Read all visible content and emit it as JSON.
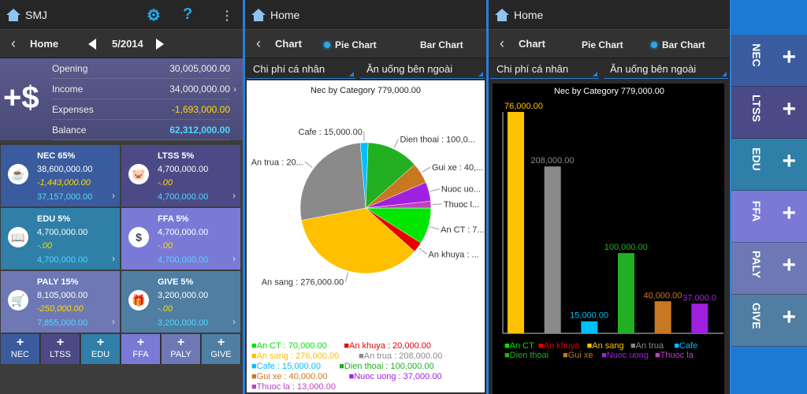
{
  "panel1": {
    "app_title": "SMJ",
    "nav": {
      "title": "Home",
      "month": "5/2014"
    },
    "summary": [
      {
        "label": "Opening",
        "value": "30,005,000.00",
        "color": "#eeeeee"
      },
      {
        "label": "Income",
        "value": "34,000,000.00",
        "color": "#eeeeee"
      },
      {
        "label": "Expenses",
        "value": "-1,693,000.00",
        "color": "#ffd700"
      },
      {
        "label": "Balance",
        "value": "62,312,000.00",
        "color": "#4fd8ff"
      }
    ],
    "tiles": [
      {
        "title": "NEC 65%",
        "v1": "38,600,000.00",
        "v2": "-1,443,000.00",
        "v3": "37,157,000.00",
        "bg": "#3a5c9e",
        "icon": "dining-icon"
      },
      {
        "title": "LTSS 5%",
        "v1": "4,700,000.00",
        "v2": "-.00",
        "v3": "4,700,000.00",
        "bg": "#4c4a86",
        "icon": "piggy-bank-icon"
      },
      {
        "title": "EDU 5%",
        "v1": "4,700,000.00",
        "v2": "-.00",
        "v3": "4,700,000.00",
        "bg": "#2f7fa8",
        "icon": "book-icon"
      },
      {
        "title": "FFA 5%",
        "v1": "4,700,000.00",
        "v2": "-.00",
        "v3": "4,700,000.00",
        "bg": "#7a7ad6",
        "icon": "money-bag-icon"
      },
      {
        "title": "PALY 15%",
        "v1": "8,105,000.00",
        "v2": "-250,000.00",
        "v3": "7,855,000.00",
        "bg": "#6e78b4",
        "icon": "shopping-cart-icon"
      },
      {
        "title": "GIVE 5%",
        "v1": "3,200,000.00",
        "v2": "-.00",
        "v3": "3,200,000.00",
        "bg": "#4f7ea2",
        "icon": "gift-icon"
      }
    ],
    "buttons": [
      {
        "label": "NEC",
        "bg": "#3a5c9e"
      },
      {
        "label": "LTSS",
        "bg": "#4c4a86"
      },
      {
        "label": "EDU",
        "bg": "#2f7fa8"
      },
      {
        "label": "FFA",
        "bg": "#7a7ad6"
      },
      {
        "label": "PALY",
        "bg": "#6e78b4"
      },
      {
        "label": "GIVE",
        "bg": "#4f7ea2"
      }
    ]
  },
  "chart_common": {
    "home": "Home",
    "chart": "Chart",
    "tab_pie": "Pie Chart",
    "tab_bar": "Bar Chart",
    "dropdown1": "Chi phí cá nhân",
    "dropdown2": "Ăn uống bên ngoài"
  },
  "chart_data": [
    {
      "type": "pie",
      "title": "Nec by Category 779,000.00",
      "slices": [
        {
          "name": "An CT",
          "value": 70000,
          "color": "#00e600",
          "label": "An CT : 7..."
        },
        {
          "name": "An khuya",
          "value": 20000,
          "color": "#e60000",
          "label": "An khuya : ..."
        },
        {
          "name": "An sang",
          "value": 276000,
          "color": "#ffc000",
          "label": "An sang : 276,000.00"
        },
        {
          "name": "An trua",
          "value": 208000,
          "color": "#8a8a8a",
          "label": "An trua : 20..."
        },
        {
          "name": "Cafe",
          "value": 15000,
          "color": "#00bfff",
          "label": "Cafe : 15,000.00"
        },
        {
          "name": "Dien thoai",
          "value": 100000,
          "color": "#22b022",
          "label": "Dien thoai : 100,0..."
        },
        {
          "name": "Gui xe",
          "value": 40000,
          "color": "#c87820",
          "label": "Gui xe : 40,..."
        },
        {
          "name": "Nuoc uong",
          "value": 37000,
          "color": "#a020e0",
          "label": "Nuoc uo..."
        },
        {
          "name": "Thuoc la",
          "value": 13000,
          "color": "#c040c0",
          "label": "Thuoc l..."
        }
      ],
      "legend": [
        [
          {
            "text": "An CT : 70,000.00",
            "color": "#00e600"
          },
          {
            "text": "An khuya : 20,000.00",
            "color": "#e60000"
          }
        ],
        [
          {
            "text": "An sang : 276,000.00",
            "color": "#ffc000"
          },
          {
            "text": "An trua : 208,000.00",
            "color": "#8a8a8a"
          }
        ],
        [
          {
            "text": "Cafe : 15,000.00",
            "color": "#00bfff"
          },
          {
            "text": "Dien thoai : 100,000.00",
            "color": "#22b022"
          }
        ],
        [
          {
            "text": "Gui xe : 40,000.00",
            "color": "#c87820"
          },
          {
            "text": "Nuoc uong : 37,000.00",
            "color": "#a020e0"
          }
        ],
        [
          {
            "text": "Thuoc la : 13,000.00",
            "color": "#c040c0"
          }
        ]
      ]
    },
    {
      "type": "bar",
      "title": "Nec by Category 779,000.00",
      "bars": [
        {
          "label": "76,000.00",
          "value": 276000,
          "color": "#ffc000"
        },
        {
          "label": "208,000.00",
          "value": 208000,
          "color": "#8a8a8a"
        },
        {
          "label": "15,000.00",
          "value": 15000,
          "color": "#00bfff"
        },
        {
          "label": "100,000.00",
          "value": 100000,
          "color": "#22b022"
        },
        {
          "label": "40,000.00",
          "value": 40000,
          "color": "#c87820"
        },
        {
          "label": "37,000.0",
          "value": 37000,
          "color": "#a020e0"
        }
      ],
      "ylim": [
        0,
        276000
      ],
      "legend": [
        [
          {
            "text": "An CT",
            "color": "#00e600"
          },
          {
            "text": "An khuya",
            "color": "#e60000"
          },
          {
            "text": "An sang",
            "color": "#ffc000"
          },
          {
            "text": "An trua",
            "color": "#8a8a8a"
          },
          {
            "text": "Cafe",
            "color": "#00bfff"
          }
        ],
        [
          {
            "text": "Dien thoai",
            "color": "#22b022"
          },
          {
            "text": "Gui xe",
            "color": "#c87820"
          },
          {
            "text": "Nuoc uong",
            "color": "#a020e0"
          },
          {
            "text": "Thuoc la",
            "color": "#c040c0"
          }
        ]
      ]
    }
  ],
  "side_tabs": [
    {
      "label": "NEC",
      "bg": "#3a5c9e"
    },
    {
      "label": "LTSS",
      "bg": "#4c4a86"
    },
    {
      "label": "EDU",
      "bg": "#2f7fa8"
    },
    {
      "label": "FFA",
      "bg": "#7a7ad6"
    },
    {
      "label": "PALY",
      "bg": "#6e78b4"
    },
    {
      "label": "GIVE",
      "bg": "#4f7ea2"
    }
  ]
}
